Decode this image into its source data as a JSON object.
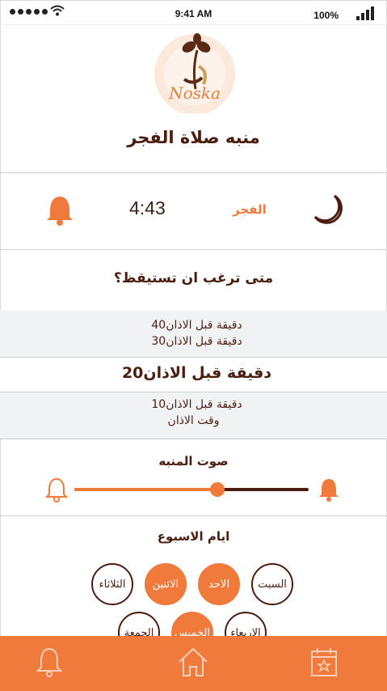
{
  "status_bar": {
    "time": "9:41 AM",
    "battery": "100%"
  },
  "logo": {
    "text": "Noska"
  },
  "page_title": "منبه صلاة الفجر",
  "prayer": {
    "name": "الفجر",
    "time": "4:43"
  },
  "question": "متى ترغب ان تستيقظ؟",
  "options": [
    {
      "num": "40",
      "label": "دقيقة قبل الاذان"
    },
    {
      "num": "30",
      "label": "دقيقة قبل الاذان"
    },
    {
      "num": "20",
      "label": "دقيقة قبل الاذان"
    },
    {
      "num": "10",
      "label": "دقيقة قبل الاذان"
    },
    {
      "num": "",
      "label": "وقت الاذان"
    }
  ],
  "selected_option_index": 2,
  "sound": {
    "title": "صوت المنبه",
    "volume_fraction": 0.61
  },
  "days": {
    "title": "ايام الاسبوع",
    "items": [
      {
        "label": "السبت",
        "selected": false
      },
      {
        "label": "الاحد",
        "selected": true
      },
      {
        "label": "الاثنين",
        "selected": true
      },
      {
        "label": "الثلاثاء",
        "selected": false
      },
      {
        "label": "الاربعاء",
        "selected": false
      },
      {
        "label": "الخميس",
        "selected": true
      },
      {
        "label": "الجمعة",
        "selected": false
      }
    ]
  },
  "tabbar": {
    "items": [
      "bell-icon",
      "home-icon",
      "calendar-icon"
    ]
  },
  "colors": {
    "accent": "#f07a3c",
    "dark": "#4a1d0f",
    "picker_bg": "#f1f2f4"
  }
}
